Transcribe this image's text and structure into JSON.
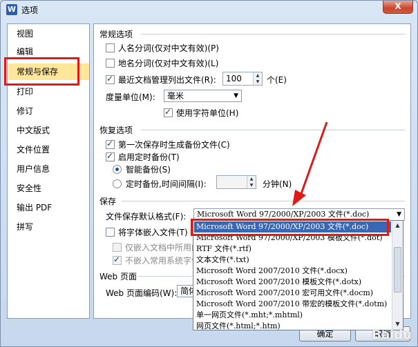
{
  "window": {
    "title": "选项",
    "app_icon": "W",
    "close_label": "X"
  },
  "sidebar": {
    "items": [
      {
        "label": "视图"
      },
      {
        "label": "编辑"
      },
      {
        "label": "常规与保存"
      },
      {
        "label": "打印"
      },
      {
        "label": "修订"
      },
      {
        "label": "中文版式"
      },
      {
        "label": "文件位置"
      },
      {
        "label": "用户信息"
      },
      {
        "label": "安全性"
      },
      {
        "label": "输出 PDF"
      },
      {
        "label": "拼写"
      }
    ],
    "active_index": 2
  },
  "general": {
    "title": "常规选项",
    "name_split": "人名分词(仅对中文有效)(P)",
    "place_split": "地名分词(仅对中文有效)(L)",
    "recent_files": "最近文档管理列出文件(R):",
    "recent_count": "100",
    "recent_unit": "个(E)",
    "measure_label": "度量单位(M):",
    "measure_value": "毫米",
    "use_char_units": "使用字符单位(H)"
  },
  "recovery": {
    "title": "恢复选项",
    "backup_first": "第一次保存时生成备份文件(C)",
    "timed_backup": "启用定时备份(T)",
    "smart_backup": "智能备份(S)",
    "interval_backup": "定时备份,时间间隔(I):",
    "interval_unit": "分钟(N)"
  },
  "save": {
    "title": "保存",
    "default_format_label": "文件保存默认格式(F):",
    "default_format_value": "Microsoft Word 97/2000/XP/2003 文件(*.doc)",
    "embed_fonts": "将字体嵌入文件(T)",
    "embed_used_only": "仅嵌入文档中所用的",
    "no_embed_common": "不嵌入常用系统字体"
  },
  "web": {
    "title": "Web 页面",
    "encoding_label": "Web 页面编码(W):",
    "encoding_value": "简体"
  },
  "dropdown": {
    "options": [
      "Microsoft Word 97/2000/XP/2003 文件(*.doc)",
      "Microsoft Word 97/2000/XP/2003 模板文件(*.dot)",
      "RTF 文件(*.rtf)",
      "文本文件(*.txt)",
      "Microsoft Word 2007/2010 文件(*.docx)",
      "Microsoft Word 2007/2010 模板文件(*.dotx)",
      "Microsoft Word 2007/2010 宏可用文件(*.docm)",
      "Microsoft Word 2007/2010 带宏的模板文件(*.dotm)",
      "单一网页文件(*.mht;*.mhtml)",
      "网页文件(*.html;*.htm)"
    ],
    "selected_index": 0
  },
  "buttons": {
    "ok": "确定",
    "cancel": "取消"
  },
  "watermark": "Baidu"
}
